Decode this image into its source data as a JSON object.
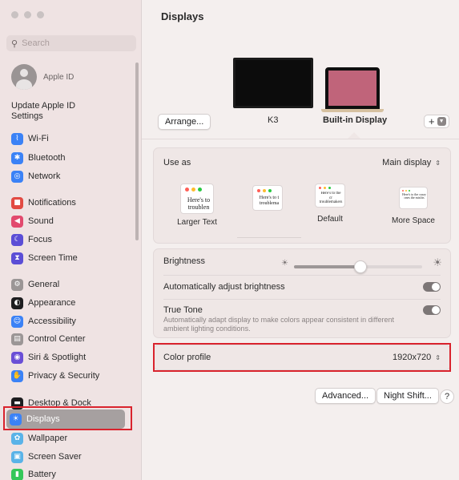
{
  "sidebar": {
    "search_placeholder": "Search",
    "apple_id": "Apple ID",
    "update_notice": "Update Apple ID Settings",
    "items": [
      {
        "label": "Wi-Fi",
        "icon": "wifi-icon",
        "color": "#3b82f6"
      },
      {
        "label": "Bluetooth",
        "icon": "bluetooth-icon",
        "color": "#3b82f6"
      },
      {
        "label": "Network",
        "icon": "globe-icon",
        "color": "#3b82f6"
      },
      {
        "label": "Notifications",
        "icon": "bell-icon",
        "color": "#e24a42"
      },
      {
        "label": "Sound",
        "icon": "speaker-icon",
        "color": "#e24a6e"
      },
      {
        "label": "Focus",
        "icon": "moon-icon",
        "color": "#5b4ed6"
      },
      {
        "label": "Screen Time",
        "icon": "hourglass-icon",
        "color": "#5b4ed6"
      },
      {
        "label": "General",
        "icon": "gear-icon",
        "color": "#9b9696"
      },
      {
        "label": "Appearance",
        "icon": "appearance-icon",
        "color": "#1d1d1f"
      },
      {
        "label": "Accessibility",
        "icon": "accessibility-icon",
        "color": "#3b82f6"
      },
      {
        "label": "Control Center",
        "icon": "control-center-icon",
        "color": "#9b9696"
      },
      {
        "label": "Siri & Spotlight",
        "icon": "siri-icon",
        "color": "#6a4fd6"
      },
      {
        "label": "Privacy & Security",
        "icon": "hand-icon",
        "color": "#3b82f6"
      },
      {
        "label": "Desktop & Dock",
        "icon": "dock-icon",
        "color": "#1d1d1f"
      },
      {
        "label": "Displays",
        "icon": "sun-icon",
        "color": "#3b82f6"
      },
      {
        "label": "Wallpaper",
        "icon": "wallpaper-icon",
        "color": "#5ab3e8"
      },
      {
        "label": "Screen Saver",
        "icon": "screen-saver-icon",
        "color": "#5ab3e8"
      },
      {
        "label": "Battery",
        "icon": "battery-icon",
        "color": "#34c759"
      }
    ],
    "selected": "Displays"
  },
  "main": {
    "title": "Displays",
    "arrange_button": "Arrange...",
    "external_display_name": "K3",
    "internal_display_name": "Built-in Display",
    "add_button": "+",
    "use_as": {
      "label": "Use as",
      "value": "Main display"
    },
    "resolutions": [
      {
        "label": "Larger Text",
        "sample": "Here's to troublen",
        "selected": false
      },
      {
        "label": "",
        "sample": "Here's to t troublema",
        "selected": false
      },
      {
        "label": "Default",
        "sample": "Here's to the cr troublemakers",
        "selected": true
      },
      {
        "label": "More Space",
        "sample": "Here's to the crazy ones the misfits",
        "selected": false
      }
    ],
    "brightness": {
      "label": "Brightness",
      "level": 0.52
    },
    "auto_brightness": {
      "label": "Automatically adjust brightness",
      "on": true
    },
    "true_tone": {
      "label": "True Tone",
      "description": "Automatically adapt display to make colors appear consistent in different ambient lighting conditions.",
      "on": true
    },
    "color_profile": {
      "label": "Color profile",
      "value": "1920x720"
    },
    "advanced_button": "Advanced...",
    "night_shift_button": "Night Shift...",
    "help_button": "?"
  },
  "colors": {
    "highlight": "#d9232d",
    "selection_blue": "#3b82f6"
  }
}
